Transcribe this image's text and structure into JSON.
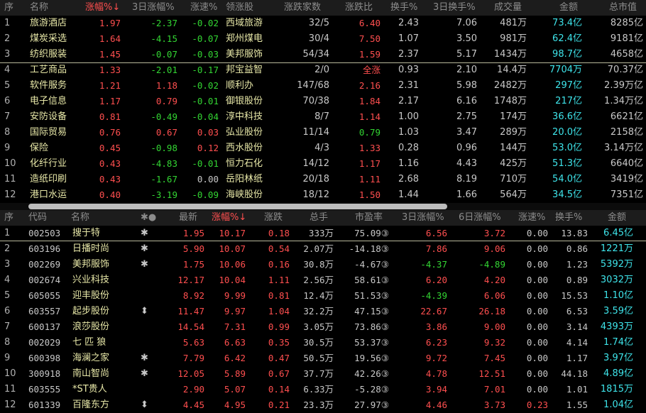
{
  "sector_table": {
    "headers": [
      "序",
      "名称",
      "涨幅%↓",
      "3日涨幅%",
      "涨速%",
      "领涨股",
      "涨跌家数",
      "涨跌比",
      "换手%",
      "3日换手%",
      "成交量",
      "金额",
      "总市值"
    ],
    "rows": [
      {
        "idx": "1",
        "name": "旅游酒店",
        "chg": "1.97",
        "chg3d": "-2.37",
        "speed": "-0.02",
        "leader": "西域旅游",
        "counts": "32/5",
        "ratio": "6.40",
        "turnover": "2.43",
        "turnover3d": "7.06",
        "volume": "481万",
        "amount": "73.4亿",
        "mcap": "8285亿"
      },
      {
        "idx": "2",
        "name": "煤炭采选",
        "chg": "1.64",
        "chg3d": "-4.15",
        "speed": "-0.07",
        "leader": "郑州煤电",
        "counts": "30/4",
        "ratio": "7.50",
        "turnover": "1.07",
        "turnover3d": "3.50",
        "volume": "981万",
        "amount": "62.4亿",
        "mcap": "9181亿"
      },
      {
        "idx": "3",
        "name": "纺织服装",
        "chg": "1.45",
        "chg3d": "-0.07",
        "speed": "-0.03",
        "leader": "美邦服饰",
        "counts": "54/34",
        "ratio": "1.59",
        "turnover": "2.37",
        "turnover3d": "5.17",
        "volume": "1434万",
        "amount": "98.7亿",
        "mcap": "4658亿"
      },
      {
        "idx": "4",
        "name": "工艺商品",
        "chg": "1.33",
        "chg3d": "-2.01",
        "speed": "-0.17",
        "leader": "邦宝益智",
        "counts": "2/0",
        "ratio": "全涨",
        "turnover": "0.93",
        "turnover3d": "2.10",
        "volume": "14.4万",
        "amount": "7704万",
        "mcap": "70.37亿"
      },
      {
        "idx": "5",
        "name": "软件服务",
        "chg": "1.21",
        "chg3d": "1.18",
        "speed": "-0.02",
        "leader": "顺利办",
        "counts": "147/68",
        "ratio": "2.16",
        "turnover": "2.31",
        "turnover3d": "5.98",
        "volume": "2482万",
        "amount": "297亿",
        "mcap": "2.39万亿"
      },
      {
        "idx": "6",
        "name": "电子信息",
        "chg": "1.17",
        "chg3d": "0.79",
        "speed": "-0.01",
        "leader": "御银股份",
        "counts": "70/38",
        "ratio": "1.84",
        "turnover": "2.17",
        "turnover3d": "6.16",
        "volume": "1748万",
        "amount": "217亿",
        "mcap": "1.34万亿"
      },
      {
        "idx": "7",
        "name": "安防设备",
        "chg": "0.81",
        "chg3d": "-0.49",
        "speed": "-0.04",
        "leader": "淳中科技",
        "counts": "8/7",
        "ratio": "1.14",
        "turnover": "1.00",
        "turnover3d": "2.75",
        "volume": "174万",
        "amount": "36.6亿",
        "mcap": "6621亿"
      },
      {
        "idx": "8",
        "name": "国际贸易",
        "chg": "0.76",
        "chg3d": "0.67",
        "speed": "0.03",
        "leader": "弘业股份",
        "counts": "11/14",
        "ratio": "0.79",
        "turnover": "1.03",
        "turnover3d": "3.47",
        "volume": "289万",
        "amount": "20.0亿",
        "mcap": "2158亿"
      },
      {
        "idx": "9",
        "name": "保险",
        "chg": "0.45",
        "chg3d": "-0.98",
        "speed": "0.12",
        "leader": "西水股份",
        "counts": "4/3",
        "ratio": "1.33",
        "turnover": "0.28",
        "turnover3d": "0.96",
        "volume": "144万",
        "amount": "53.0亿",
        "mcap": "3.14万亿"
      },
      {
        "idx": "10",
        "name": "化纤行业",
        "chg": "0.43",
        "chg3d": "-4.83",
        "speed": "-0.01",
        "leader": "恒力石化",
        "counts": "14/12",
        "ratio": "1.17",
        "turnover": "1.16",
        "turnover3d": "4.43",
        "volume": "425万",
        "amount": "51.3亿",
        "mcap": "6640亿"
      },
      {
        "idx": "11",
        "name": "造纸印刷",
        "chg": "0.43",
        "chg3d": "-1.67",
        "speed": "0.00",
        "leader": "岳阳林纸",
        "counts": "20/18",
        "ratio": "1.11",
        "turnover": "2.68",
        "turnover3d": "8.19",
        "volume": "710万",
        "amount": "54.0亿",
        "mcap": "3419亿"
      },
      {
        "idx": "12",
        "name": "港口水运",
        "chg": "0.40",
        "chg3d": "-3.19",
        "speed": "-0.09",
        "leader": "海峡股份",
        "counts": "18/12",
        "ratio": "1.50",
        "turnover": "1.44",
        "turnover3d": "1.66",
        "volume": "564万",
        "amount": "34.5亿",
        "mcap": "7351亿"
      }
    ]
  },
  "stock_table": {
    "headers": [
      "序",
      "代码",
      "名称",
      "✱●",
      "最新",
      "涨幅%↓",
      "涨跌",
      "总手",
      "市盈率",
      "3日涨幅%",
      "6日涨幅%",
      "涨速%",
      "换手%",
      "金额"
    ],
    "rows": [
      {
        "idx": "1",
        "code": "002503",
        "name": "搜于特",
        "flag": "✱",
        "price": "1.95",
        "chg": "10.17",
        "diff": "0.18",
        "vol": "333万",
        "pe": "75.09③",
        "chg3d": "6.56",
        "chg6d": "3.72",
        "speed": "0.00",
        "turnover": "13.83",
        "amount": "6.45亿"
      },
      {
        "idx": "2",
        "code": "603196",
        "name": "日播时尚",
        "flag": "✱",
        "price": "5.90",
        "chg": "10.07",
        "diff": "0.54",
        "vol": "2.07万",
        "pe": "-14.18③",
        "chg3d": "7.86",
        "chg6d": "9.06",
        "speed": "0.00",
        "turnover": "0.86",
        "amount": "1221万"
      },
      {
        "idx": "3",
        "code": "002269",
        "name": "美邦服饰",
        "flag": "✱",
        "price": "1.75",
        "chg": "10.06",
        "diff": "0.16",
        "vol": "30.8万",
        "pe": "-4.67③",
        "chg3d": "-4.37",
        "chg6d": "-4.89",
        "speed": "0.00",
        "turnover": "1.23",
        "amount": "5392万"
      },
      {
        "idx": "4",
        "code": "002674",
        "name": "兴业科技",
        "flag": "",
        "price": "12.17",
        "chg": "10.04",
        "diff": "1.11",
        "vol": "2.56万",
        "pe": "58.61③",
        "chg3d": "6.20",
        "chg6d": "4.20",
        "speed": "0.00",
        "turnover": "0.89",
        "amount": "3032万"
      },
      {
        "idx": "5",
        "code": "605055",
        "name": "迎丰股份",
        "flag": "",
        "price": "8.92",
        "chg": "9.99",
        "diff": "0.81",
        "vol": "12.4万",
        "pe": "51.53③",
        "chg3d": "-4.39",
        "chg6d": "6.06",
        "speed": "0.00",
        "turnover": "15.53",
        "amount": "1.10亿"
      },
      {
        "idx": "6",
        "code": "603557",
        "name": "起步股份",
        "flag": "⬍",
        "price": "11.47",
        "chg": "9.97",
        "diff": "1.04",
        "vol": "32.2万",
        "pe": "47.15③",
        "chg3d": "22.67",
        "chg6d": "26.18",
        "speed": "0.00",
        "turnover": "6.53",
        "amount": "3.59亿"
      },
      {
        "idx": "7",
        "code": "600137",
        "name": "浪莎股份",
        "flag": "",
        "price": "14.54",
        "chg": "7.31",
        "diff": "0.99",
        "vol": "3.05万",
        "pe": "73.86③",
        "chg3d": "3.86",
        "chg6d": "9.00",
        "speed": "0.00",
        "turnover": "3.14",
        "amount": "4393万"
      },
      {
        "idx": "8",
        "code": "002029",
        "name": "七 匹 狼",
        "flag": "",
        "price": "5.63",
        "chg": "6.63",
        "diff": "0.35",
        "vol": "30.5万",
        "pe": "53.37③",
        "chg3d": "6.23",
        "chg6d": "9.32",
        "speed": "0.00",
        "turnover": "4.14",
        "amount": "1.74亿"
      },
      {
        "idx": "9",
        "code": "600398",
        "name": "海澜之家",
        "flag": "✱",
        "price": "7.79",
        "chg": "6.42",
        "diff": "0.47",
        "vol": "50.5万",
        "pe": "19.56③",
        "chg3d": "9.72",
        "chg6d": "7.45",
        "speed": "0.00",
        "turnover": "1.17",
        "amount": "3.97亿"
      },
      {
        "idx": "10",
        "code": "300918",
        "name": "南山智尚",
        "flag": "✱",
        "price": "12.05",
        "chg": "5.89",
        "diff": "0.67",
        "vol": "37.7万",
        "pe": "42.26③",
        "chg3d": "4.78",
        "chg6d": "12.51",
        "speed": "0.00",
        "turnover": "44.18",
        "amount": "4.89亿"
      },
      {
        "idx": "11",
        "code": "603555",
        "name": "*ST贵人",
        "flag": "",
        "price": "2.90",
        "chg": "5.07",
        "diff": "0.14",
        "vol": "6.33万",
        "pe": "-5.28③",
        "chg3d": "3.94",
        "chg6d": "7.01",
        "speed": "0.00",
        "turnover": "1.01",
        "amount": "1815万"
      },
      {
        "idx": "12",
        "code": "601339",
        "name": "百隆东方",
        "flag": "⬍",
        "price": "4.45",
        "chg": "4.95",
        "diff": "0.21",
        "vol": "23.3万",
        "pe": "27.97③",
        "chg3d": "4.46",
        "chg6d": "3.73",
        "speed": "0.23",
        "turnover": "1.55",
        "amount": "1.04亿"
      }
    ]
  },
  "colors": {
    "up": "#ff4f4f",
    "down": "#33d633",
    "flat": "#c8c8c8",
    "amount": "#3ee4ea",
    "header_bg": "#1c1c1c",
    "separator": "#b7b79a"
  }
}
